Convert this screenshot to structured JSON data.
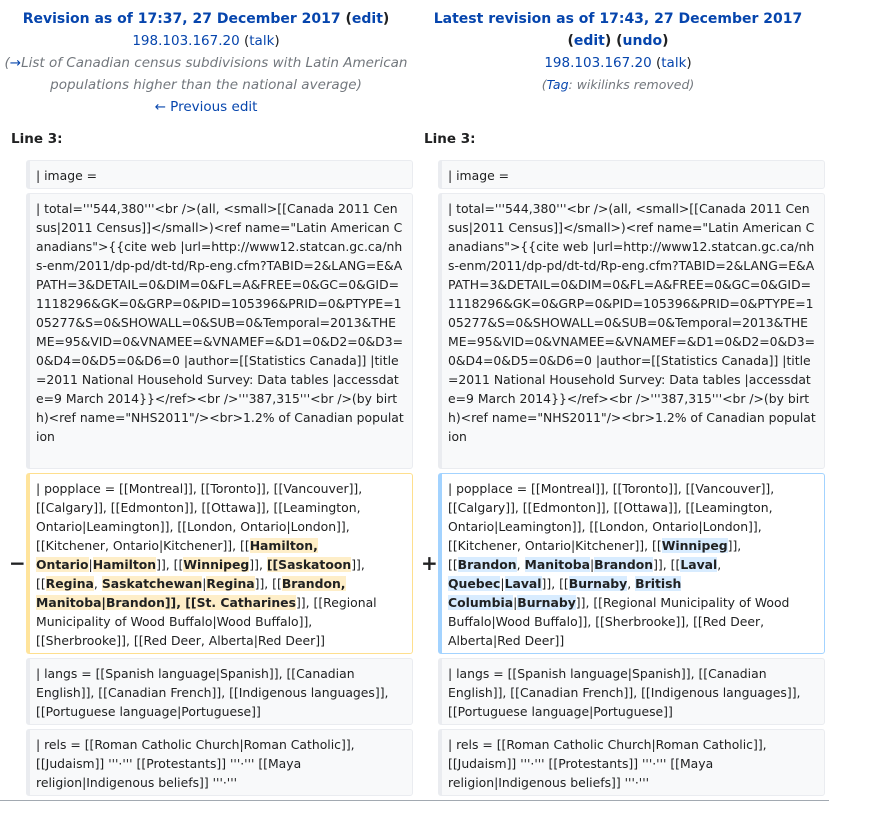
{
  "left_header": {
    "title": "Revision as of 17:37, 27 December 2017",
    "edit_paren_open": " (",
    "edit": "edit",
    "edit_paren_close": ")",
    "user": "198.103.167.20",
    "talk": "talk",
    "comment_arrow": "→",
    "comment_text": "List of Canadian census subdivisions with Latin American populations higher than the national average",
    "previous_edit": "← Previous edit"
  },
  "right_header": {
    "title": "Latest revision as of 17:43, 27 December 2017",
    "edit": "edit",
    "undo": "undo",
    "user": "198.103.167.20",
    "talk": "talk",
    "tag_label": "Tag",
    "tag_value": "wikilinks removed"
  },
  "line_label": "Line 3:",
  "markers": {
    "minus": "−",
    "plus": "+"
  },
  "rows": {
    "image": "| image =",
    "total": "| total='''544,380'''<br />(all, <small>[[Canada 2011 Census|2011 Census]]</small>)<ref name=\"Latin American Canadians\">{{cite web |url=http://www12.statcan.gc.ca/nhs-enm/2011/dp-pd/dt-td/Rp-eng.cfm?TABID=2&LANG=E&APATH=3&DETAIL=0&DIM=0&FL=A&FREE=0&GC=0&GID=1118296&GK=0&GRP=0&PID=105396&PRID=0&PTYPE=105277&S=0&SHOWALL=0&SUB=0&Temporal=2013&THEME=95&VID=0&VNAMEE=&VNAMEF=&D1=0&D2=0&D3=0&D4=0&D5=0&D6=0 |author=[[Statistics Canada]] |title=2011 National Household Survey: Data tables |accessdate=9 March 2014}}</ref><br />'''387,315'''<br />(by birth)<ref name=\"NHS2011\"/><br>1.2% of Canadian population",
    "langs": "| langs = [[Spanish language|Spanish]], [[Canadian English]], [[Canadian French]], [[Indigenous languages]], [[Portuguese language|Portuguese]]",
    "rels": "| rels = [[Roman Catholic Church|Roman Catholic]], [[Judaism]] '''·''' [[Protestants]] '''·''' [[Maya religion|Indigenous beliefs]] '''·'''"
  },
  "popplace_old": {
    "p1": "| popplace = [[Montreal]], [[Toronto]], [[Vancouver]], [[Calgary]], [[Edmonton]], [[Ottawa]], [[Leamington, Ontario|Leamington]], [[London, Ontario|London]], [[Kitchener, Ontario|Kitchener]], [[",
    "h1": "Hamilton, Ontario",
    "p2": "|",
    "h2": "Hamilton",
    "p3": "]], [[",
    "h3": "Winnipeg",
    "p4": "]], ",
    "h4": "[[Saskatoon",
    "p5": "]], [[",
    "h5": "Regina",
    "p6": ", ",
    "h6": "Saskatchewan",
    "p7": "|",
    "h7": "Regina",
    "p8": "]], [[",
    "h8": "Brandon, Manitoba|Brandon]], [[St. Catharines",
    "p9": "]], [[Regional Municipality of Wood Buffalo|Wood Buffalo]], [[Sherbrooke]], [[Red Deer, Alberta|Red Deer]]"
  },
  "popplace_new": {
    "p1": "| popplace = [[Montreal]], [[Toronto]], [[Vancouver]], [[Calgary]], [[Edmonton]], [[Ottawa]], [[Leamington, Ontario|Leamington]], [[London, Ontario|London]], [[Kitchener, Ontario|Kitchener]], [[",
    "h1": "Winnipeg",
    "p2": "]], [[",
    "h2": "Brandon",
    "p3": ", ",
    "h3": "Manitoba",
    "p4": "|",
    "h4": "Brandon",
    "p5": "]], [[",
    "h5": "Laval",
    "p6": ", ",
    "h6": "Quebec",
    "p7": "|",
    "h7": "Laval",
    "p8": "]], [[",
    "h8": "Burnaby",
    "p9": ", ",
    "h9": "British Columbia",
    "p10": "|",
    "h10": "Burnaby",
    "p11": "]], [[Regional Municipality of Wood Buffalo|Wood Buffalo]], [[Sherbrooke]], [[Red Deer, Alberta|Red Deer]]"
  }
}
